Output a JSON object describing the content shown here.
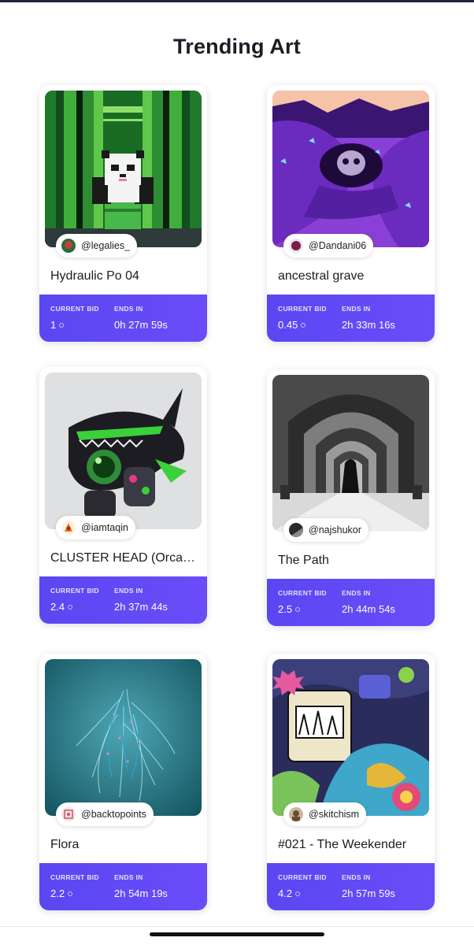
{
  "page": {
    "title": "Trending Art"
  },
  "labels": {
    "current_bid": "CURRENT BID",
    "ends_in": "ENDS IN"
  },
  "cards": [
    {
      "owner": "@legalies_",
      "title": "Hydraulic Po 04",
      "bid": "1",
      "ends": "0h 27m 59s",
      "image_icon": "panda-pixel-art-icon",
      "avatar_icon": "avatar-icon"
    },
    {
      "owner": "@Dandani06",
      "title": "ancestral grave",
      "bid": "0.45",
      "ends": "2h 33m 16s",
      "image_icon": "skull-cave-art-icon",
      "avatar_icon": "avatar-icon"
    },
    {
      "owner": "@iamtaqin",
      "title": "CLUSTER HEAD (Orcann...",
      "bid": "2.4",
      "ends": "2h 37m 44s",
      "image_icon": "orca-toy-art-icon",
      "avatar_icon": "avatar-icon"
    },
    {
      "owner": "@najshukor",
      "title": "The Path",
      "bid": "2.5",
      "ends": "2h 44m 54s",
      "image_icon": "arch-corridor-photo-icon",
      "avatar_icon": "avatar-icon"
    },
    {
      "owner": "@backtopoints",
      "title": "Flora",
      "bid": "2.2",
      "ends": "2h 54m 19s",
      "image_icon": "flora-strands-art-icon",
      "avatar_icon": "avatar-icon"
    },
    {
      "owner": "@skitchism",
      "title": "#021 - The Weekender",
      "bid": "4.2",
      "ends": "2h 57m 59s",
      "image_icon": "doodle-art-icon",
      "avatar_icon": "avatar-icon"
    }
  ],
  "colors": {
    "accent": "#5a47f2",
    "accent_end": "#6a4cf8"
  }
}
